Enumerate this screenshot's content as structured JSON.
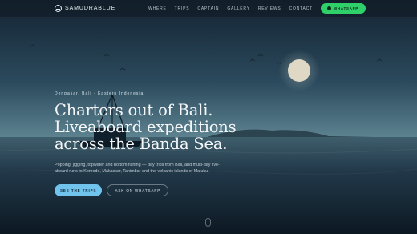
{
  "brand": {
    "name": "SAMUDRABLUE",
    "icon": "wave-circle-icon"
  },
  "nav": {
    "links": [
      "WHERE",
      "TRIPS",
      "CAPTAIN",
      "GALLERY",
      "REVIEWS",
      "CONTACT"
    ],
    "whatsapp_label": "WHATSAPP",
    "whatsapp_color": "#2fd06a"
  },
  "hero": {
    "eyebrow": "Denpasar, Bali · Eastern Indonesia",
    "headline_lines": [
      "Charters out of Bali.",
      "Liveaboard expeditions",
      "across the Banda Sea."
    ],
    "subtext": "Popping, jigging, topwater and bottom fishing — day trips from Bali, and multi-day live-aboard runs to Komodo, Makassar, Tanimbar and the volcanic islands of Maluku.",
    "primary_cta": "SEE THE TRIPS",
    "secondary_cta": "ASK ON WHATSAPP",
    "accent_color": "#6fc3ec"
  },
  "scroll_indicator": {
    "icon": "mouse-scroll-icon"
  }
}
